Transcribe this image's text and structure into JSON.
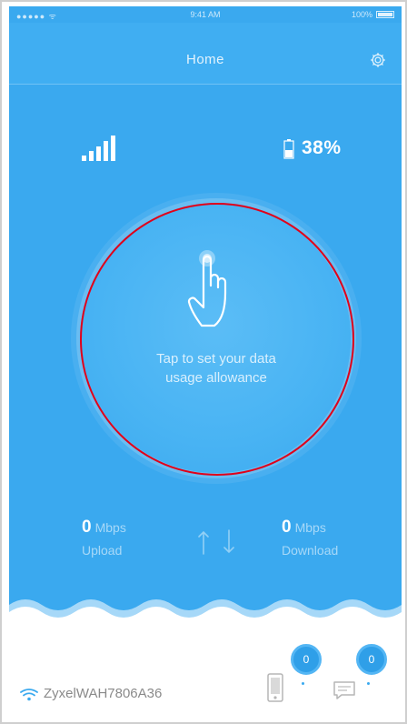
{
  "status_bar": {
    "carrier": "●●●●● ᯤ",
    "time": "9:41 AM",
    "battery": "100%"
  },
  "nav": {
    "title": "Home"
  },
  "status": {
    "battery_percent": "38%"
  },
  "dial": {
    "prompt_line1": "Tap to set your data",
    "prompt_line2": "usage allowance"
  },
  "speeds": {
    "upload_value": "0",
    "upload_unit": "Mbps",
    "upload_label": "Upload",
    "download_value": "0",
    "download_unit": "Mbps",
    "download_label": "Download"
  },
  "footer": {
    "ssid": "ZyxelWAH7806A36",
    "devices_count": "0",
    "messages_count": "0"
  },
  "icons": {
    "settings": "gear-icon",
    "signal": "signal-icon",
    "battery": "battery-icon",
    "tap": "tap-hand-icon",
    "wifi": "wifi-icon",
    "device": "device-icon",
    "messages": "message-icon"
  },
  "colors": {
    "primary": "#3aa9ef",
    "badge": "#2f9fe8",
    "highlight": "#e0001a"
  }
}
